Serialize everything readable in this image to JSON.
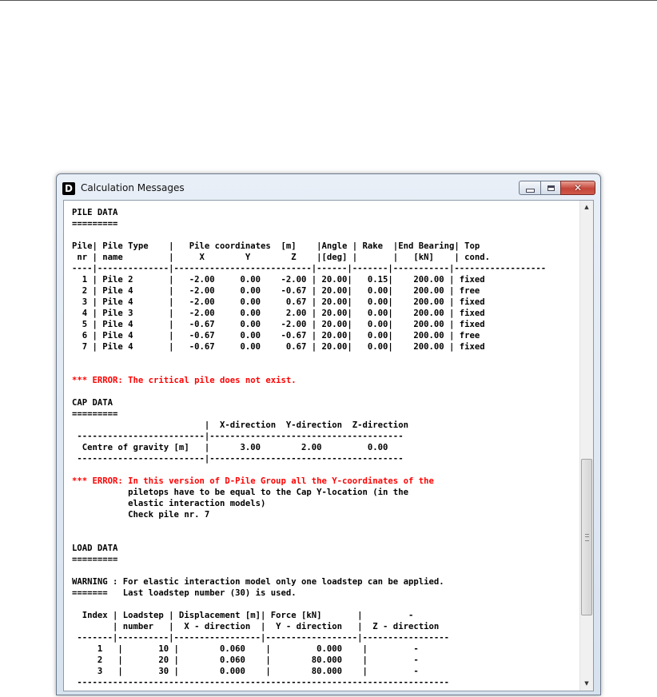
{
  "window": {
    "title": "Calculation Messages",
    "icon_letter": "D",
    "controls": {
      "minimize": "minimize-icon",
      "maximize": "maximize-icon",
      "close": "✕"
    }
  },
  "icons": {
    "scroll_up": "▲",
    "scroll_down": "▼"
  },
  "colors": {
    "error_text": "#ff0000",
    "normal_text": "#000000",
    "close_button": "#c4463a"
  },
  "report": {
    "lines": [
      {
        "text": "PILE DATA",
        "type": "normal"
      },
      {
        "text": "=========",
        "type": "normal"
      },
      {
        "text": "",
        "type": "normal"
      },
      {
        "text": "Pile| Pile Type    |   Pile coordinates  [m]    |Angle | Rake  |End Bearing| Top",
        "type": "normal"
      },
      {
        "text": " nr | name         |     X        Y        Z    |[deg] |       |   [kN]    | cond.",
        "type": "normal"
      },
      {
        "text": "----|--------------|---------------------------|------|-------|-----------|------------------",
        "type": "normal"
      },
      {
        "text": "  1 | Pile 2       |   -2.00     0.00    -2.00 | 20.00|   0.15|    200.00 | fixed",
        "type": "normal"
      },
      {
        "text": "  2 | Pile 4       |   -2.00     0.00    -0.67 | 20.00|   0.00|    200.00 | free",
        "type": "normal"
      },
      {
        "text": "  3 | Pile 4       |   -2.00     0.00     0.67 | 20.00|   0.00|    200.00 | fixed",
        "type": "normal"
      },
      {
        "text": "  4 | Pile 3       |   -2.00     0.00     2.00 | 20.00|   0.00|    200.00 | fixed",
        "type": "normal"
      },
      {
        "text": "  5 | Pile 4       |   -0.67     0.00    -2.00 | 20.00|   0.00|    200.00 | fixed",
        "type": "normal"
      },
      {
        "text": "  6 | Pile 4       |   -0.67     0.00    -0.67 | 20.00|   0.00|    200.00 | free",
        "type": "normal"
      },
      {
        "text": "  7 | Pile 4       |   -0.67     0.00     0.67 | 20.00|   0.00|    200.00 | fixed",
        "type": "normal"
      },
      {
        "text": "",
        "type": "normal"
      },
      {
        "text": "",
        "type": "normal"
      },
      {
        "text": "*** ERROR: The critical pile does not exist.",
        "type": "error"
      },
      {
        "text": "",
        "type": "normal"
      },
      {
        "text": "CAP DATA",
        "type": "normal"
      },
      {
        "text": "=========",
        "type": "normal"
      },
      {
        "text": "                          |  X-direction  Y-direction  Z-direction",
        "type": "normal"
      },
      {
        "text": " -------------------------|--------------------------------------",
        "type": "normal"
      },
      {
        "text": "  Centre of gravity [m]   |      3.00        2.00         0.00",
        "type": "normal"
      },
      {
        "text": " -------------------------|--------------------------------------",
        "type": "normal"
      },
      {
        "text": "",
        "type": "normal"
      },
      {
        "text": "*** ERROR: In this version of D-Pile Group all the Y-coordinates of the",
        "type": "error"
      },
      {
        "text": "           piletops have to be equal to the Cap Y-location (in the",
        "type": "normal"
      },
      {
        "text": "           elastic interaction models)",
        "type": "normal"
      },
      {
        "text": "           Check pile nr. 7",
        "type": "normal"
      },
      {
        "text": "",
        "type": "normal"
      },
      {
        "text": "",
        "type": "normal"
      },
      {
        "text": "LOAD DATA",
        "type": "normal"
      },
      {
        "text": "=========",
        "type": "normal"
      },
      {
        "text": "",
        "type": "normal"
      },
      {
        "text": "WARNING : For elastic interaction model only one loadstep can be applied.",
        "type": "normal"
      },
      {
        "text": "=======   Last loadstep number (30) is used.",
        "type": "normal"
      },
      {
        "text": "",
        "type": "normal"
      },
      {
        "text": "  Index | Loadstep | Displacement [m]| Force [kN]       |         -",
        "type": "normal"
      },
      {
        "text": "        | number   |  X - direction  |  Y - direction   |  Z - direction",
        "type": "normal"
      },
      {
        "text": " -------|----------|-----------------|------------------|-----------------",
        "type": "normal"
      },
      {
        "text": "     1   |       10 |        0.060    |         0.000    |         -",
        "type": "normal"
      },
      {
        "text": "     2   |       20 |        0.060    |        80.000    |         -",
        "type": "normal"
      },
      {
        "text": "     3   |       30 |        0.000    |        80.000    |         -",
        "type": "normal"
      },
      {
        "text": " -------------------------------------------------------------------------",
        "type": "normal"
      }
    ]
  }
}
